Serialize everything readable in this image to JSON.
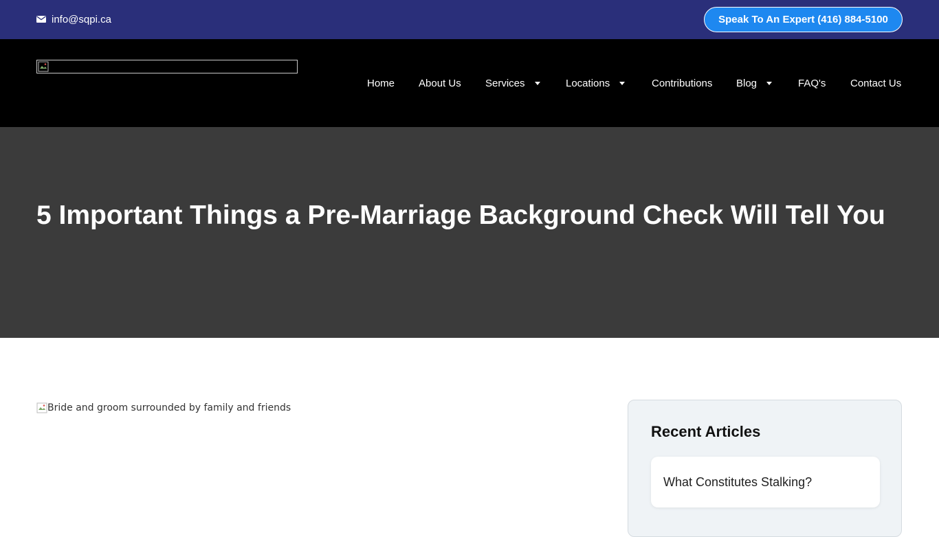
{
  "topbar": {
    "email": "info@sqpi.ca",
    "cta_label": "Speak To An Expert (416) 884-5100"
  },
  "nav": {
    "items": [
      {
        "label": "Home"
      },
      {
        "label": "About Us"
      },
      {
        "label": "Services"
      },
      {
        "label": "Locations"
      },
      {
        "label": "Contributions"
      },
      {
        "label": "Blog"
      },
      {
        "label": "FAQ's"
      },
      {
        "label": "Contact Us"
      }
    ]
  },
  "hero": {
    "title": "5 Important Things a Pre-Marriage Background Check Will Tell You"
  },
  "article": {
    "image_alt": "Bride and groom surrounded by family and friends"
  },
  "sidebar": {
    "heading": "Recent Articles",
    "articles": [
      {
        "title": "What Constitutes Stalking?"
      }
    ]
  },
  "colors": {
    "topbar": "#2a2f7a",
    "cta": "#1e88f0",
    "navbar": "#000000",
    "hero": "#3b3b3b",
    "sidebar": "#eff3f6"
  }
}
